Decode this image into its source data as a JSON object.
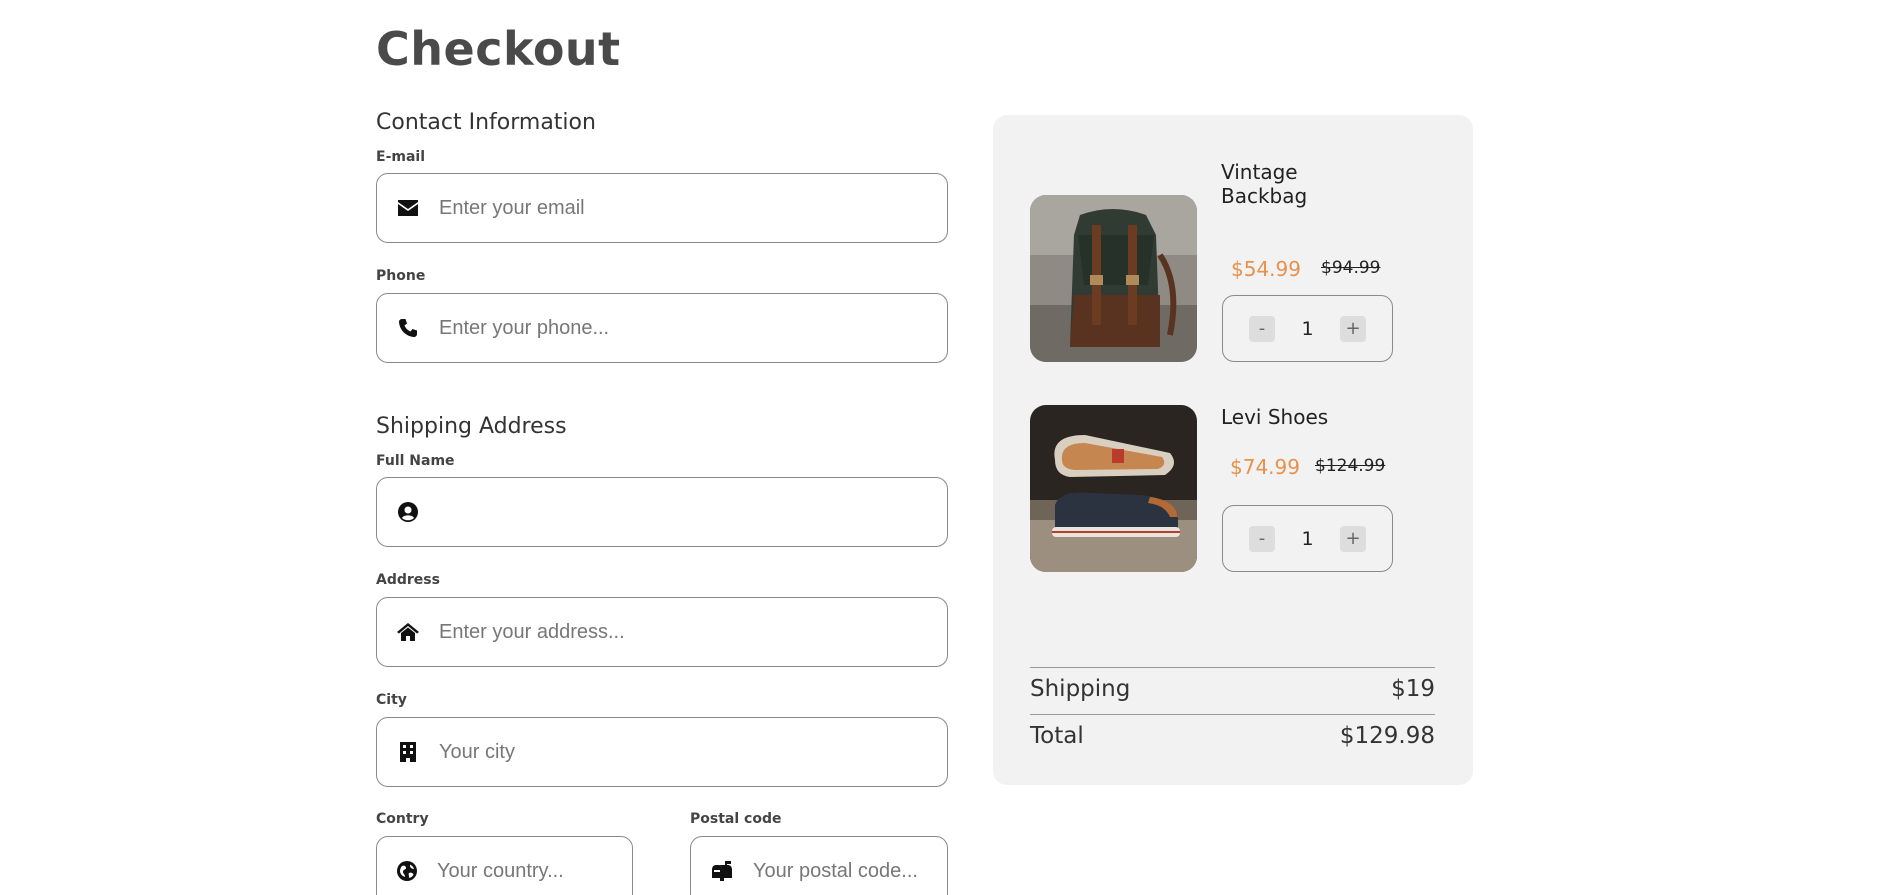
{
  "page": {
    "title": "Checkout"
  },
  "contact": {
    "title": "Contact Information",
    "email": {
      "label": "E-mail",
      "placeholder": "Enter your email",
      "value": ""
    },
    "phone": {
      "label": "Phone",
      "placeholder": "Enter your phone...",
      "value": ""
    }
  },
  "shipping": {
    "title": "Shipping Address",
    "full_name": {
      "label": "Full Name",
      "placeholder": "",
      "value": ""
    },
    "address": {
      "label": "Address",
      "placeholder": "Enter your address...",
      "value": ""
    },
    "city": {
      "label": "City",
      "placeholder": "Your city",
      "value": ""
    },
    "country": {
      "label": "Contry",
      "placeholder": "Your country...",
      "value": ""
    },
    "postal": {
      "label": "Postal code",
      "placeholder": "Your postal code...",
      "value": ""
    }
  },
  "cart": {
    "items": [
      {
        "name": "Vintage Backbag",
        "price": "$54.99",
        "old_price": "$94.99",
        "qty": "1",
        "minus": "-",
        "plus": "+"
      },
      {
        "name": "Levi Shoes",
        "price": "$74.99",
        "old_price": "$124.99",
        "qty": "1",
        "minus": "-",
        "plus": "+"
      }
    ],
    "shipping_label": "Shipping",
    "shipping_value": "$19",
    "total_label": "Total",
    "total_value": "$129.98"
  },
  "icons": [
    "envelope-icon",
    "phone-icon",
    "user-circle-icon",
    "home-icon",
    "building-icon",
    "globe-icon",
    "mailbox-icon"
  ],
  "colors": {
    "accent_price": "#e8914a",
    "card_bg": "#f2f2f2",
    "title": "#4a4a4a"
  }
}
